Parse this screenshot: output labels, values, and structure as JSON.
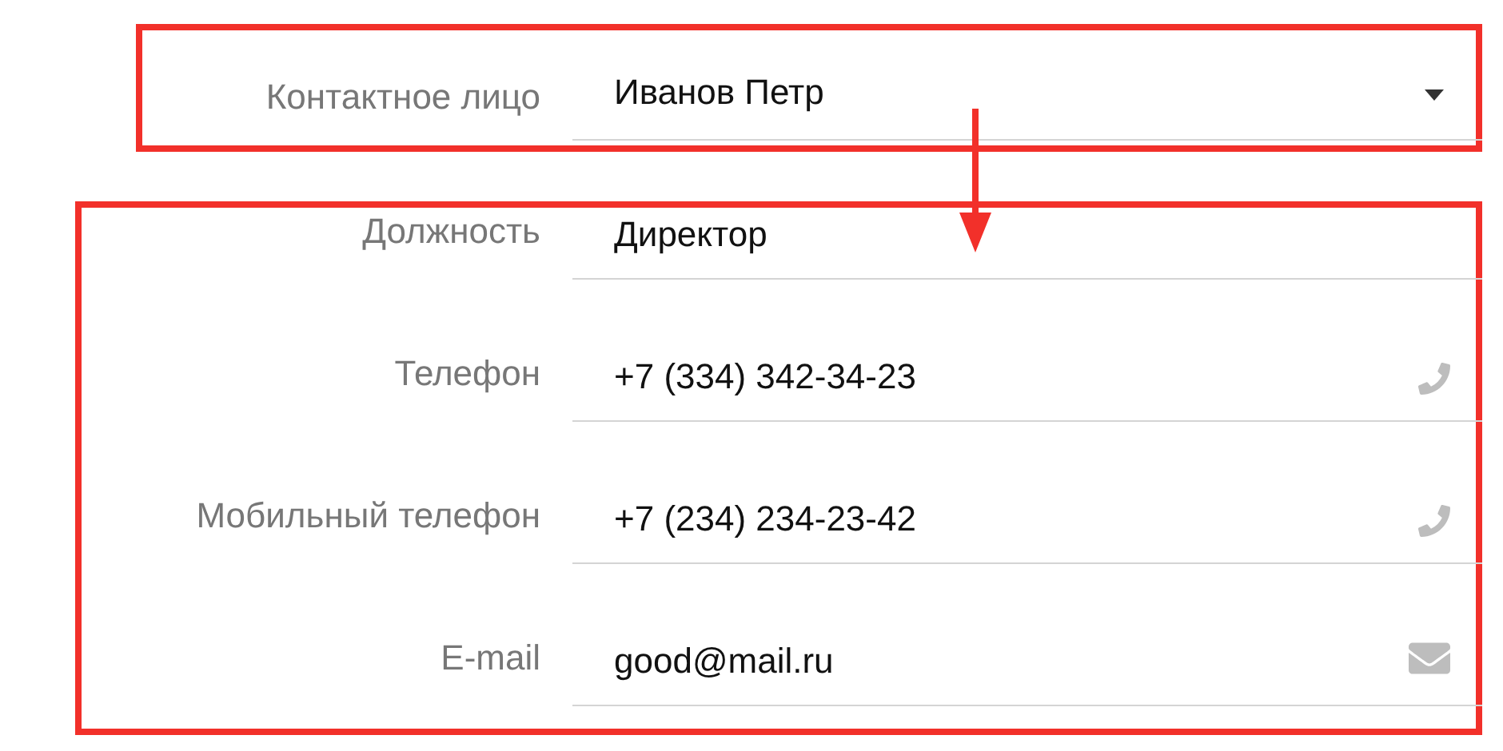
{
  "contact": {
    "label": "Контактное лицо",
    "value": "Иванов Петр"
  },
  "fields": [
    {
      "label": "Должность",
      "value": "Директор",
      "kind": "text"
    },
    {
      "label": "Телефон",
      "value": "+7 (334) 342-34-23",
      "kind": "phone"
    },
    {
      "label": "Мобильный телефон",
      "value": "+7 (234) 234-23-42",
      "kind": "phone"
    },
    {
      "label": "E-mail",
      "value": "good@mail.ru",
      "kind": "email"
    }
  ]
}
